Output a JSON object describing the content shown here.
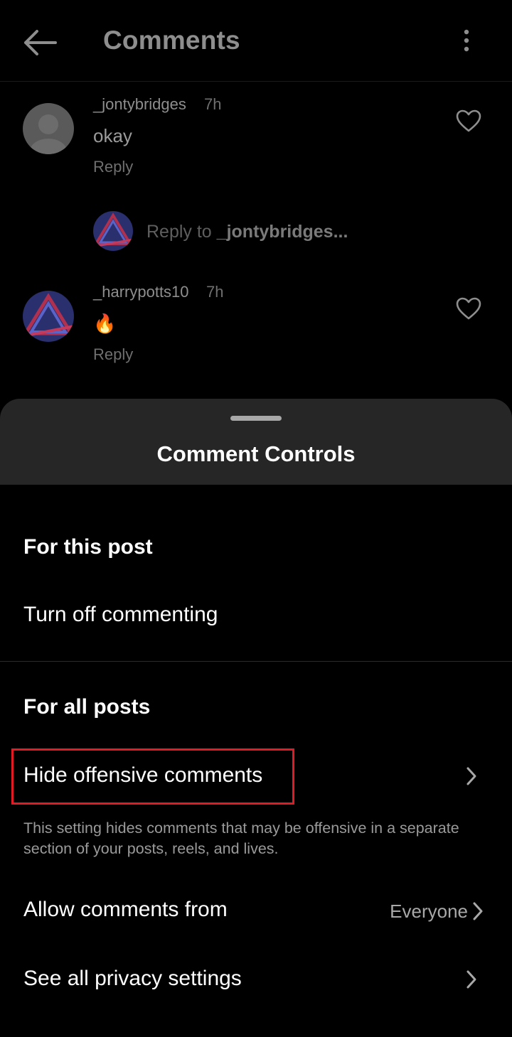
{
  "header": {
    "title": "Comments"
  },
  "comments": [
    {
      "username": "_jontybridges",
      "time": "7h",
      "text": "okay",
      "reply_label": "Reply"
    },
    {
      "username": "_harrypotts10",
      "time": "7h",
      "text": "🔥",
      "reply_label": "Reply"
    }
  ],
  "reply_prompt": {
    "prefix": "Reply to ",
    "target": "_jontybridges..."
  },
  "sheet": {
    "title": "Comment Controls",
    "section_this_post": "For this post",
    "turn_off_commenting": "Turn off commenting",
    "section_all_posts": "For all posts",
    "hide_offensive": "Hide offensive comments",
    "hide_offensive_help": "This setting hides comments that may be offensive in a separate section of your posts, reels, and lives.",
    "allow_comments_from": "Allow comments from",
    "allow_comments_value": "Everyone",
    "privacy_settings": "See all privacy settings"
  },
  "colors": {
    "highlight_border": "#e01b24",
    "sheet_header_bg": "#262626",
    "background": "#000000"
  }
}
